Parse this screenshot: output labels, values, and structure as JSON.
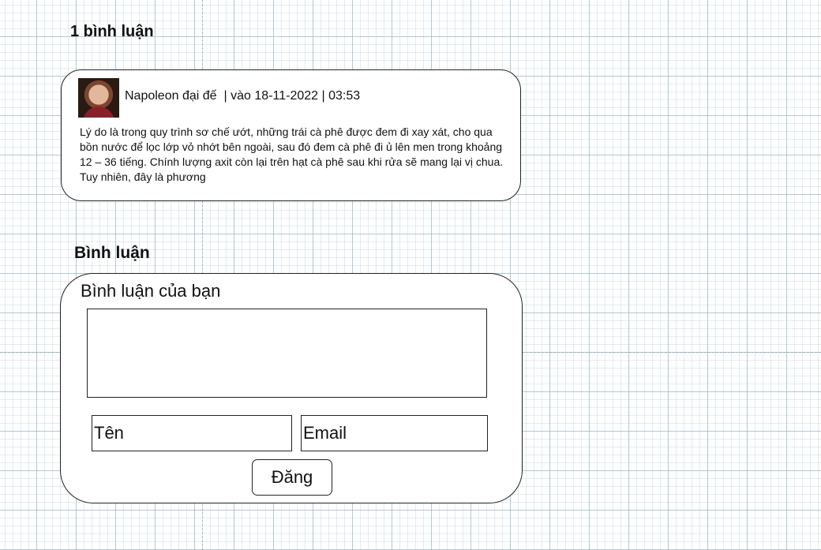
{
  "comments_section": {
    "count_heading": "1 bình luận",
    "comments": [
      {
        "author": "Napoleon đại đế",
        "date_text": "| vào 18-11-2022 | 03:53",
        "body": "Lý do là trong quy trình sơ chế ướt, những trái cà phê được đem đi xay xát, cho qua bồn nước để lọc lớp vỏ nhớt bên ngoài, sau đó đem cà phê đi ủ lên men trong khoảng 12 – 36 tiếng. Chính lượng axit còn lại trên hạt cà phê sau khi rửa sẽ mang lại vị chua. Tuy nhiên, đây là phương"
      }
    ]
  },
  "comment_form": {
    "heading": "Bình luận",
    "label": "Bình luận của bạn",
    "comment_value": "",
    "name_placeholder": "Tên",
    "email_placeholder": "Email",
    "submit_label": "Đăng"
  }
}
